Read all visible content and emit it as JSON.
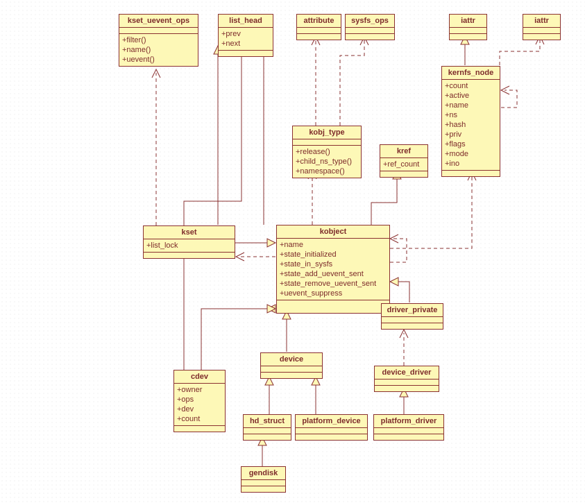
{
  "diagram": {
    "classes": {
      "kset_uevent_ops": {
        "name": "kset_uevent_ops",
        "attrs": [],
        "ops": [
          "+filter()",
          "+name()",
          "+uevent()"
        ]
      },
      "list_head": {
        "name": "list_head",
        "attrs": [
          "+prev",
          "+next"
        ],
        "ops": []
      },
      "attribute": {
        "name": "attribute",
        "attrs": [],
        "ops": []
      },
      "sysfs_ops": {
        "name": "sysfs_ops",
        "attrs": [],
        "ops": []
      },
      "iattr1": {
        "name": "iattr",
        "attrs": [],
        "ops": []
      },
      "iattr2": {
        "name": "iattr",
        "attrs": [],
        "ops": []
      },
      "kernfs_node": {
        "name": "kernfs_node",
        "attrs": [
          "+count",
          "+active",
          "+name",
          "+ns",
          "+hash",
          "+priv",
          "+flags",
          "+mode",
          "+ino"
        ],
        "ops": []
      },
      "kobj_type": {
        "name": "kobj_type",
        "attrs": [],
        "ops": [
          "+release()",
          "+child_ns_type()",
          "+namespace()"
        ]
      },
      "kref": {
        "name": "kref",
        "attrs": [
          "+ref_count"
        ],
        "ops": []
      },
      "kset": {
        "name": "kset",
        "attrs": [
          "+list_lock"
        ],
        "ops": []
      },
      "kobject": {
        "name": "kobject",
        "attrs": [
          "+name",
          "+state_initialized",
          "+state_in_sysfs",
          "+state_add_uevent_sent",
          "+state_remove_uevent_sent",
          "+uevent_suppress"
        ],
        "ops": []
      },
      "driver_private": {
        "name": "driver_private",
        "attrs": [],
        "ops": []
      },
      "cdev": {
        "name": "cdev",
        "attrs": [
          "+owner",
          "+ops",
          "+dev",
          "+count"
        ],
        "ops": []
      },
      "device": {
        "name": "device",
        "attrs": [],
        "ops": []
      },
      "device_driver": {
        "name": "device_driver",
        "attrs": [],
        "ops": []
      },
      "hd_struct": {
        "name": "hd_struct",
        "attrs": [],
        "ops": []
      },
      "platform_device": {
        "name": "platform_device",
        "attrs": [],
        "ops": []
      },
      "platform_driver": {
        "name": "platform_driver",
        "attrs": [],
        "ops": []
      },
      "gendisk": {
        "name": "gendisk",
        "attrs": [],
        "ops": []
      }
    }
  }
}
